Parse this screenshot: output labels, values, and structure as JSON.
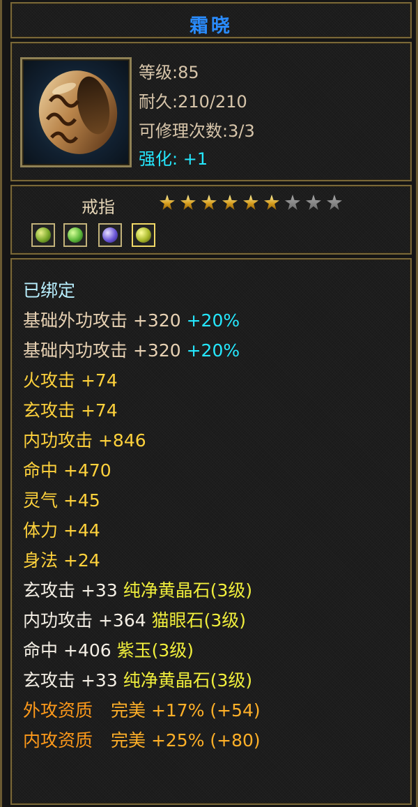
{
  "title": "霜晓",
  "item_stats": {
    "level": "等级:85",
    "durability": "耐久:210/210",
    "repair": "可修理次数:3/3",
    "enhance_label": "强化:",
    "enhance_value": "+1"
  },
  "item_type": "戒指",
  "star_rating": {
    "filled": 6,
    "total": 9
  },
  "gems": [
    "yellow-green-gem-icon",
    "green-gem-icon",
    "purple-gem-icon",
    "yellow-gem-icon"
  ],
  "attributes": {
    "bound": "已绑定",
    "base_outer": {
      "label": "基础外功攻击",
      "value": "+320",
      "bonus": "+20%"
    },
    "base_inner": {
      "label": "基础内功攻击",
      "value": "+320",
      "bonus": "+20%"
    },
    "basic": [
      {
        "label": "火攻击",
        "value": "+74"
      },
      {
        "label": "玄攻击",
        "value": "+74"
      },
      {
        "label": "内功攻击",
        "value": "+846"
      },
      {
        "label": "命中",
        "value": "+470"
      },
      {
        "label": "灵气",
        "value": "+45"
      },
      {
        "label": "体力",
        "value": "+44"
      },
      {
        "label": "身法",
        "value": "+24"
      }
    ],
    "gem_stats": [
      {
        "label": "玄攻击",
        "value": "+33",
        "gem": "纯净黄晶石(3级)"
      },
      {
        "label": "内功攻击",
        "value": "+364",
        "gem": "猫眼石(3级)"
      },
      {
        "label": "命中",
        "value": "+406",
        "gem": "紫玉(3级)"
      },
      {
        "label": "玄攻击",
        "value": "+33",
        "gem": "纯净黄晶石(3级)"
      }
    ],
    "quality": [
      {
        "label": "外攻资质",
        "grade": "完美",
        "value": "+17%",
        "extra": "(+54)"
      },
      {
        "label": "内攻资质",
        "grade": "完美",
        "value": "+25%",
        "extra": "(+80)"
      }
    ]
  },
  "colors": {
    "title": "#2a8cff",
    "enhance": "#25e8ff",
    "basic_attr": "#ffd23c",
    "gem_name": "#f0ee3c",
    "quality": "#ff9a1a"
  }
}
